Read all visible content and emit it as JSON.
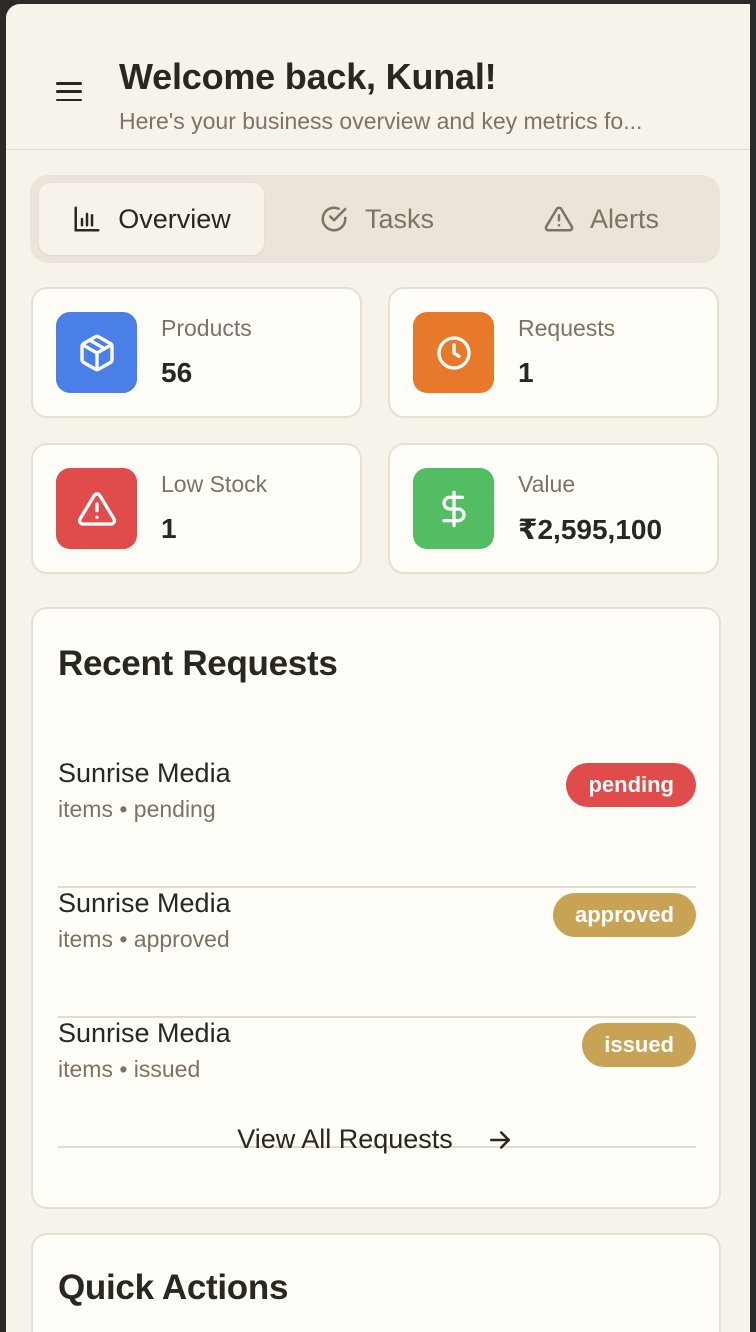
{
  "header": {
    "title": "Welcome back, Kunal!",
    "subtitle": "Here's your business overview and key metrics fo..."
  },
  "tabs": [
    {
      "label": "Overview",
      "icon": "bar-chart-icon",
      "active": true
    },
    {
      "label": "Tasks",
      "icon": "check-circle-icon",
      "active": false
    },
    {
      "label": "Alerts",
      "icon": "warning-triangle-icon",
      "active": false
    }
  ],
  "stats": [
    {
      "label": "Products",
      "value": "56",
      "icon": "box-icon",
      "color": "#4a7fe8"
    },
    {
      "label": "Requests",
      "value": "1",
      "icon": "clock-icon",
      "color": "#e8782a"
    },
    {
      "label": "Low Stock",
      "value": "1",
      "icon": "warning-triangle-icon",
      "color": "#e04b4b"
    },
    {
      "label": "Value",
      "value": "₹2,595,100",
      "icon": "dollar-icon",
      "color": "#52bd62"
    }
  ],
  "recent_requests": {
    "title": "Recent Requests",
    "items": [
      {
        "name": "Sunrise Media",
        "meta": "items • pending",
        "status": "pending",
        "status_color": "#e04b4b"
      },
      {
        "name": "Sunrise Media",
        "meta": "items • approved",
        "status": "approved",
        "status_color": "#c9a355"
      },
      {
        "name": "Sunrise Media",
        "meta": "items • issued",
        "status": "issued",
        "status_color": "#c9a355"
      }
    ],
    "view_all_label": "View All Requests"
  },
  "quick_actions": {
    "title": "Quick Actions"
  }
}
